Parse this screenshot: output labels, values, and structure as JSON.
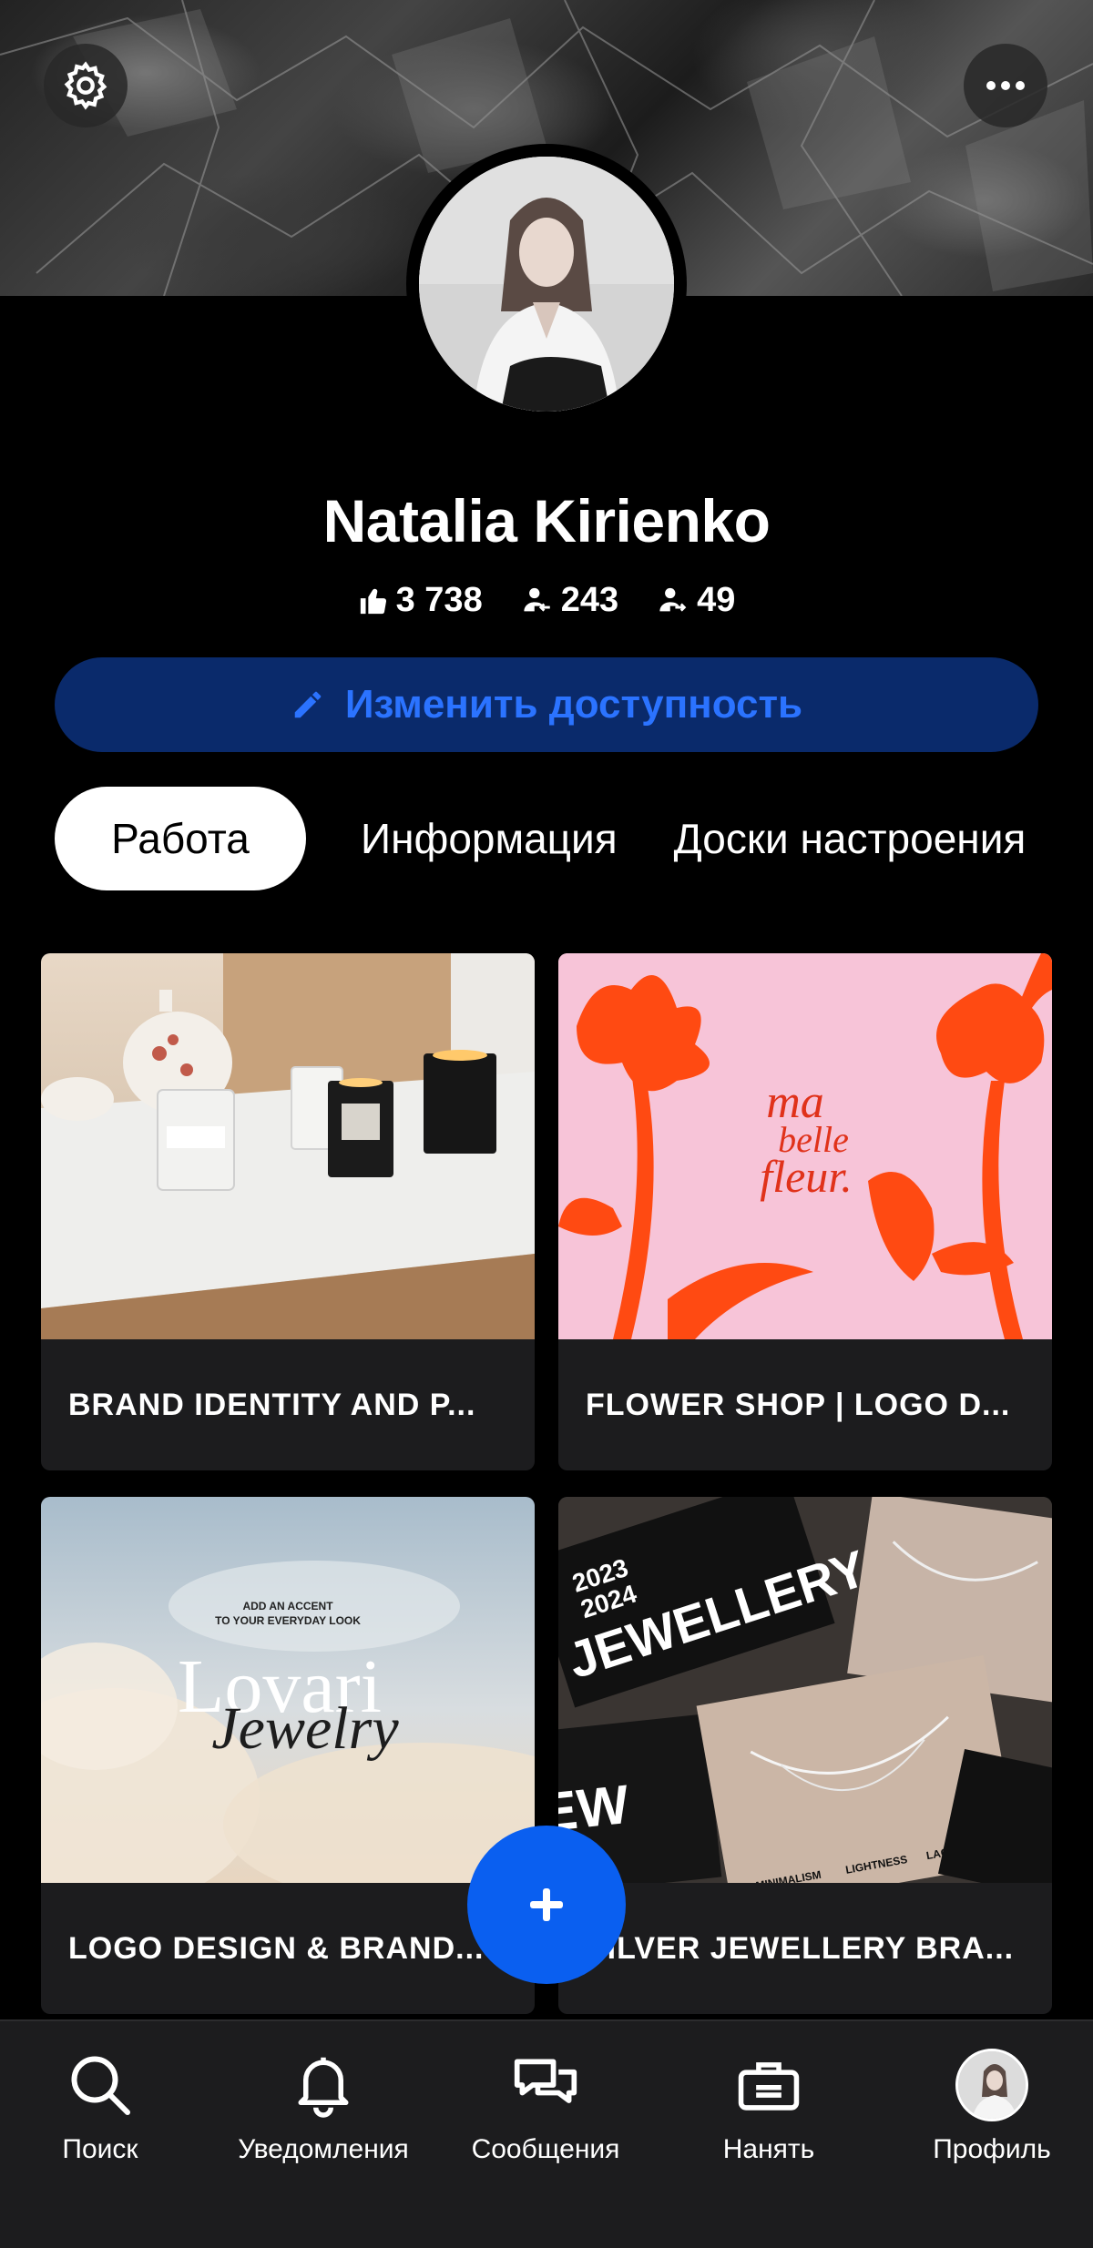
{
  "header": {
    "settings_icon": "gear-icon",
    "more_icon": "ellipsis-icon"
  },
  "profile": {
    "name": "Natalia Kirienko",
    "stats": {
      "likes": "3 738",
      "followers": "243",
      "following": "49"
    },
    "availability_button": "Изменить доступность"
  },
  "tabs": [
    {
      "label": "Работа",
      "active": true
    },
    {
      "label": "Информация",
      "active": false
    },
    {
      "label": "Доски настроения",
      "active": false
    }
  ],
  "projects": [
    {
      "title": "BRAND IDENTITY AND P..."
    },
    {
      "title": "FLOWER SHOP | LOGO D...",
      "thumb_text": [
        "ma",
        "belle",
        "fleur."
      ]
    },
    {
      "title": "LOGO DESIGN & BRAND...",
      "thumb_text": [
        "ADD AN ACCENT",
        "TO YOUR EVERYDAY LOOK",
        "Lovari",
        "Jewelry"
      ]
    },
    {
      "title": "SILVER JEWELLERY BRA...",
      "thumb_text": [
        "2023",
        "2024",
        "JEWELLERY",
        "MINIMALISM",
        "LIGHTNESS",
        "LACONISM"
      ]
    }
  ],
  "fab_label": "+",
  "bottom_nav": [
    {
      "label": "Поиск",
      "icon": "search-icon"
    },
    {
      "label": "Уведомления",
      "icon": "bell-icon"
    },
    {
      "label": "Сообщения",
      "icon": "chat-icon"
    },
    {
      "label": "Нанять",
      "icon": "briefcase-icon"
    },
    {
      "label": "Профиль",
      "icon": "avatar"
    }
  ],
  "colors": {
    "accent": "#0a5ff0",
    "availability_bg": "#0a2a6b",
    "availability_text": "#2b73ff",
    "card_bg": "#1c1c1e",
    "flower_pink": "#f7c4d8",
    "flower_orange": "#ff4a12"
  }
}
